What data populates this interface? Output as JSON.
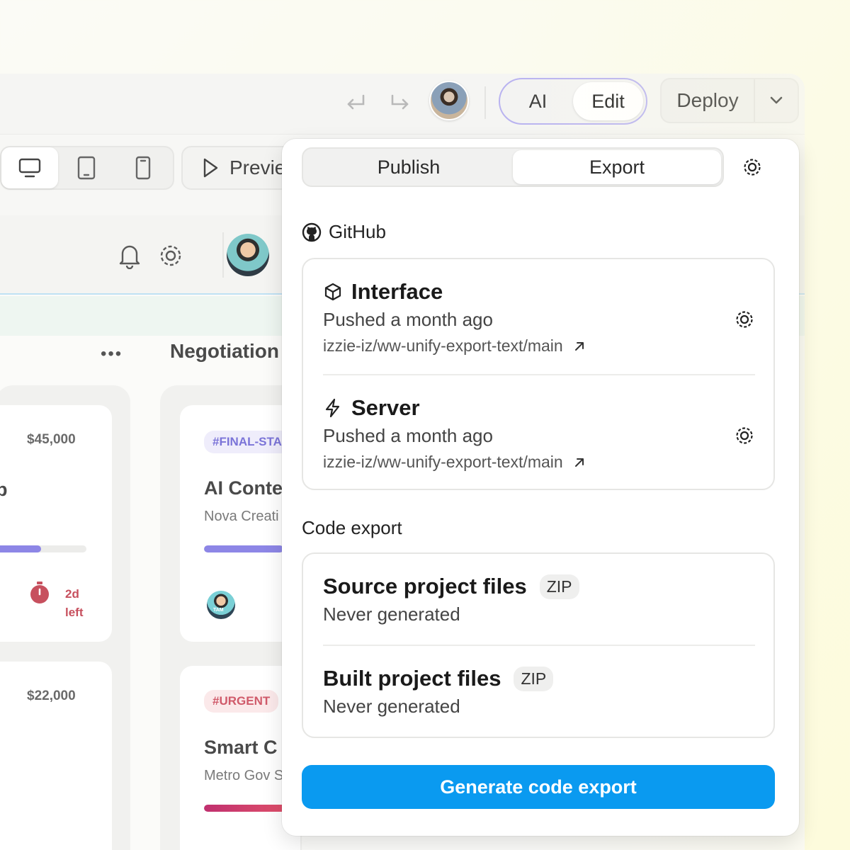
{
  "toolbar": {
    "mode_options": [
      "AI",
      "Edit"
    ],
    "active_mode": "Edit",
    "deploy_label": "Deploy",
    "preview_label": "Previe"
  },
  "canvas": {
    "column_title": "Negotiation",
    "cards": [
      {
        "price": "$45,000",
        "title_fragment": "p",
        "due_value": "2d",
        "due_unit": "left",
        "progress": 0.55
      },
      {
        "price": "$22,000"
      },
      {
        "tag": "#FINAL-STA",
        "title": "AI Conte",
        "company": "Nova Creati",
        "progress": 0.8
      },
      {
        "tag": "#URGENT",
        "title": "Smart C",
        "company": "Metro Gov S",
        "progress": 0.85
      }
    ],
    "avatar_initials": "TAM"
  },
  "colors": {
    "accent_blue": "#0a9af0",
    "progress_purple": "#8d86e6",
    "progress_pink": "#d03a7a",
    "tag_purple": "#7b74d8",
    "tag_red": "#d05a6a"
  },
  "popover": {
    "tabs": [
      "Publish",
      "Export"
    ],
    "active_tab": "Export",
    "github_label": "GitHub",
    "repos": [
      {
        "name": "Interface",
        "icon": "cube-icon",
        "status": "Pushed a month ago",
        "link": "izzie-iz/ww-unify-export-text/main"
      },
      {
        "name": "Server",
        "icon": "bolt-icon",
        "status": "Pushed a month ago",
        "link": "izzie-iz/ww-unify-export-text/main"
      }
    ],
    "code_export_label": "Code export",
    "exports": [
      {
        "name": "Source project files",
        "badge": "ZIP",
        "status": "Never generated"
      },
      {
        "name": "Built project files",
        "badge": "ZIP",
        "status": "Never generated"
      }
    ],
    "generate_label": "Generate code export"
  }
}
